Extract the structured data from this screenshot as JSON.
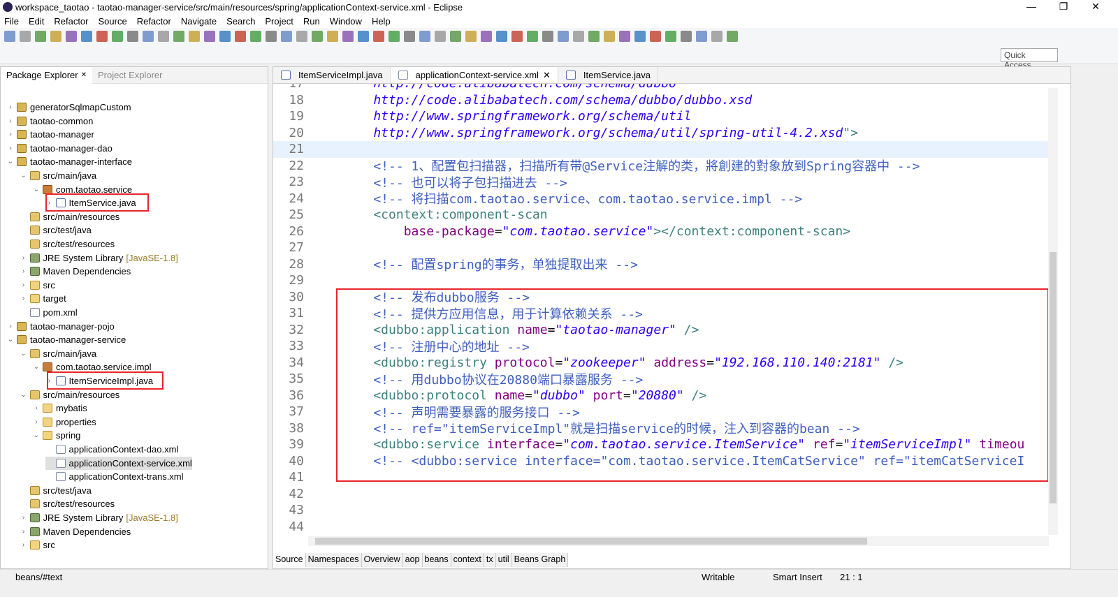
{
  "window": {
    "title": "workspace_taotao - taotao-manager-service/src/main/resources/spring/applicationContext-service.xml - Eclipse",
    "controls": [
      "—",
      "❐",
      "✕"
    ]
  },
  "menu": [
    "File",
    "Edit",
    "Refactor",
    "Source",
    "Refactor",
    "Navigate",
    "Search",
    "Project",
    "Run",
    "Window",
    "Help"
  ],
  "quick_access": {
    "placeholder": "Quick Access"
  },
  "left_panel": {
    "tabs": [
      {
        "label": "Package Explorer",
        "active": true
      },
      {
        "label": "Project Explorer",
        "active": false
      }
    ],
    "tree": [
      {
        "level": 0,
        "label": "generatorSqlmapCustom",
        "icon": "project",
        "arrow": "›"
      },
      {
        "level": 0,
        "label": "taotao-common",
        "icon": "project",
        "arrow": "›"
      },
      {
        "level": 0,
        "label": "taotao-manager",
        "icon": "project",
        "arrow": "›"
      },
      {
        "level": 0,
        "label": "taotao-manager-dao",
        "icon": "project",
        "arrow": "›"
      },
      {
        "level": 0,
        "label": "taotao-manager-interface",
        "icon": "project",
        "arrow": "⌄"
      },
      {
        "level": 1,
        "label": "src/main/java",
        "icon": "srcfolder",
        "arrow": "⌄"
      },
      {
        "level": 2,
        "label": "com.taotao.service",
        "icon": "package",
        "arrow": "⌄"
      },
      {
        "level": 3,
        "label": "ItemService.java",
        "icon": "java",
        "arrow": "›",
        "highlight": true
      },
      {
        "level": 1,
        "label": "src/main/resources",
        "icon": "srcfolder",
        "arrow": ""
      },
      {
        "level": 1,
        "label": "src/test/java",
        "icon": "srcfolder",
        "arrow": ""
      },
      {
        "level": 1,
        "label": "src/test/resources",
        "icon": "srcfolder",
        "arrow": ""
      },
      {
        "level": 1,
        "label": "JRE System Library",
        "icon": "lib",
        "arrow": "›",
        "deco": "[JavaSE-1.8]"
      },
      {
        "level": 1,
        "label": "Maven Dependencies",
        "icon": "lib",
        "arrow": "›"
      },
      {
        "level": 1,
        "label": "src",
        "icon": "folder",
        "arrow": "›"
      },
      {
        "level": 1,
        "label": "target",
        "icon": "folder",
        "arrow": "›"
      },
      {
        "level": 1,
        "label": "pom.xml",
        "icon": "xml",
        "arrow": ""
      },
      {
        "level": 0,
        "label": "taotao-manager-pojo",
        "icon": "project",
        "arrow": "›"
      },
      {
        "level": 0,
        "label": "taotao-manager-service",
        "icon": "project",
        "arrow": "⌄"
      },
      {
        "level": 1,
        "label": "src/main/java",
        "icon": "srcfolder",
        "arrow": "⌄"
      },
      {
        "level": 2,
        "label": "com.taotao.service.impl",
        "icon": "package",
        "arrow": "⌄"
      },
      {
        "level": 3,
        "label": "ItemServiceImpl.java",
        "icon": "java",
        "arrow": "›",
        "highlight": true
      },
      {
        "level": 1,
        "label": "src/main/resources",
        "icon": "srcfolder",
        "arrow": "⌄"
      },
      {
        "level": 2,
        "label": "mybatis",
        "icon": "folder",
        "arrow": "›"
      },
      {
        "level": 2,
        "label": "properties",
        "icon": "folder",
        "arrow": "›"
      },
      {
        "level": 2,
        "label": "spring",
        "icon": "folder",
        "arrow": "⌄"
      },
      {
        "level": 3,
        "label": "applicationContext-dao.xml",
        "icon": "xml",
        "arrow": ""
      },
      {
        "level": 3,
        "label": "applicationContext-service.xml",
        "icon": "xml",
        "arrow": "",
        "selected": true
      },
      {
        "level": 3,
        "label": "applicationContext-trans.xml",
        "icon": "xml",
        "arrow": ""
      },
      {
        "level": 1,
        "label": "src/test/java",
        "icon": "srcfolder",
        "arrow": ""
      },
      {
        "level": 1,
        "label": "src/test/resources",
        "icon": "srcfolder",
        "arrow": ""
      },
      {
        "level": 1,
        "label": "JRE System Library",
        "icon": "lib",
        "arrow": "›",
        "deco": "[JavaSE-1.8]"
      },
      {
        "level": 1,
        "label": "Maven Dependencies",
        "icon": "lib",
        "arrow": "›"
      },
      {
        "level": 1,
        "label": "src",
        "icon": "folder",
        "arrow": "›"
      }
    ]
  },
  "editor": {
    "tabs": [
      {
        "label": "ItemServiceImpl.java",
        "active": false
      },
      {
        "label": "applicationContext-service.xml",
        "active": true,
        "close": "✕"
      },
      {
        "label": "ItemService.java",
        "active": false
      }
    ],
    "lines": [
      {
        "n": "17",
        "segs": [
          [
            "url",
            "    http://code.alibabatech.com/schema/dubbo"
          ]
        ]
      },
      {
        "n": "18",
        "segs": [
          [
            "url",
            "    http://code.alibabatech.com/schema/dubbo/dubbo.xsd"
          ]
        ]
      },
      {
        "n": "19",
        "segs": [
          [
            "url",
            "    http://www.springframework.org/schema/util"
          ]
        ]
      },
      {
        "n": "20",
        "segs": [
          [
            "url",
            "    http://www.springframework.org/schema/util/spring-util-4.2.xsd"
          ],
          [
            "tag",
            "\">"
          ]
        ]
      },
      {
        "n": "21",
        "segs": [],
        "current": true
      },
      {
        "n": "22",
        "segs": [
          [
            "cmt",
            "    <!-- 1、配置包扫描器，扫描所有带@Service注解的类，將創建的對象放到Spring容器中 -->"
          ]
        ]
      },
      {
        "n": "23",
        "segs": [
          [
            "cmt",
            "    <!-- 也可以将子包扫描进去 -->"
          ]
        ]
      },
      {
        "n": "24",
        "segs": [
          [
            "cmt",
            "    <!-- 将扫描com.taotao.service、com.taotao.service.impl -->"
          ]
        ]
      },
      {
        "n": "25",
        "segs": [
          [
            "tag",
            "    <context:component-scan"
          ]
        ]
      },
      {
        "n": "26",
        "segs": [
          [
            "plain",
            "        "
          ],
          [
            "attr",
            "base-package"
          ],
          [
            "plain",
            "="
          ],
          [
            "val",
            "\"com.taotao.service\""
          ],
          [
            "tag",
            "></context:component-scan>"
          ]
        ]
      },
      {
        "n": "27",
        "segs": []
      },
      {
        "n": "28",
        "segs": [
          [
            "cmt",
            "    <!-- 配置spring的事务，单独提取出来 -->"
          ]
        ]
      },
      {
        "n": "29",
        "segs": []
      },
      {
        "n": "30",
        "segs": [
          [
            "cmt",
            "    <!-- 发布dubbo服务 -->"
          ]
        ]
      },
      {
        "n": "31",
        "segs": [
          [
            "cmt",
            "    <!-- 提供方应用信息，用于计算依赖关系 -->"
          ]
        ]
      },
      {
        "n": "32",
        "segs": [
          [
            "tag",
            "    <dubbo:application "
          ],
          [
            "attr",
            "name"
          ],
          [
            "plain",
            "="
          ],
          [
            "val",
            "\"taotao-manager\""
          ],
          [
            "tag",
            " />"
          ]
        ]
      },
      {
        "n": "33",
        "segs": [
          [
            "cmt",
            "    <!-- 注册中心的地址 -->"
          ]
        ]
      },
      {
        "n": "34",
        "segs": [
          [
            "tag",
            "    <dubbo:registry "
          ],
          [
            "attr",
            "protocol"
          ],
          [
            "plain",
            "="
          ],
          [
            "val",
            "\"zookeeper\""
          ],
          [
            "plain",
            " "
          ],
          [
            "attr",
            "address"
          ],
          [
            "plain",
            "="
          ],
          [
            "val",
            "\"192.168.110.140:2181\""
          ],
          [
            "tag",
            " />"
          ]
        ]
      },
      {
        "n": "35",
        "segs": [
          [
            "cmt",
            "    <!-- 用dubbo协议在20880端口暴露服务 -->"
          ]
        ]
      },
      {
        "n": "36",
        "segs": [
          [
            "tag",
            "    <dubbo:protocol "
          ],
          [
            "attr",
            "name"
          ],
          [
            "plain",
            "="
          ],
          [
            "val",
            "\"dubbo\""
          ],
          [
            "plain",
            " "
          ],
          [
            "attr",
            "port"
          ],
          [
            "plain",
            "="
          ],
          [
            "val",
            "\"20880\""
          ],
          [
            "tag",
            " />"
          ]
        ]
      },
      {
        "n": "37",
        "segs": [
          [
            "cmt",
            "    <!-- 声明需要暴露的服务接口 -->"
          ]
        ]
      },
      {
        "n": "38",
        "segs": [
          [
            "cmt",
            "    <!-- ref=\"itemServiceImpl\"就是扫描service的时候，注入到容器的bean -->"
          ]
        ]
      },
      {
        "n": "39",
        "segs": [
          [
            "tag",
            "    <dubbo:service "
          ],
          [
            "attr",
            "interface"
          ],
          [
            "plain",
            "="
          ],
          [
            "val",
            "\"com.taotao.service.ItemService\""
          ],
          [
            "plain",
            " "
          ],
          [
            "attr",
            "ref"
          ],
          [
            "plain",
            "="
          ],
          [
            "val",
            "\"itemServiceImpl\""
          ],
          [
            "plain",
            " "
          ],
          [
            "attr",
            "timeou"
          ]
        ]
      },
      {
        "n": "40",
        "segs": [
          [
            "cmt",
            "    <!-- <dubbo:service interface=\"com.taotao.service.ItemCatService\" ref=\"itemCatServiceI"
          ]
        ]
      },
      {
        "n": "41",
        "segs": []
      },
      {
        "n": "42",
        "segs": []
      },
      {
        "n": "43",
        "segs": []
      },
      {
        "n": "44",
        "segs": []
      }
    ],
    "bottom_tabs": [
      {
        "label": "Source",
        "active": true
      },
      {
        "label": "Namespaces"
      },
      {
        "label": "Overview"
      },
      {
        "label": "aop"
      },
      {
        "label": "beans"
      },
      {
        "label": "context"
      },
      {
        "label": "tx"
      },
      {
        "label": "util"
      },
      {
        "label": "Beans Graph"
      }
    ]
  },
  "status": {
    "path": "beans/#text",
    "writable": "Writable",
    "insert_mode": "Smart Insert",
    "position": "21 : 1"
  },
  "colors": {
    "highlight_box": "#e8252b",
    "tag": "#3f7f7f",
    "attr": "#7f007f",
    "value": "#2a00ff",
    "comment": "#3f5fbf"
  }
}
